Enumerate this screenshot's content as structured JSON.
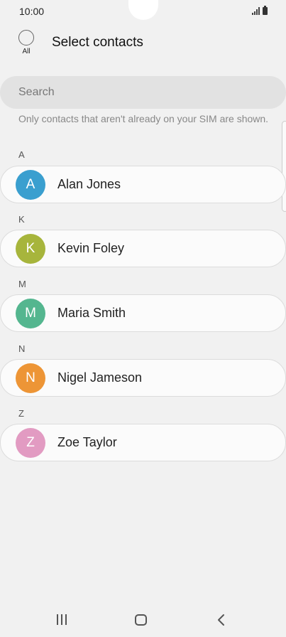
{
  "status_bar": {
    "time": "10:00"
  },
  "header": {
    "select_all_label": "All",
    "title": "Select contacts"
  },
  "search": {
    "placeholder": "Search"
  },
  "info_note": "Only contacts that aren't already on your SIM are shown.",
  "sections": [
    {
      "letter": "A",
      "contact": {
        "initial": "A",
        "name": "Alan Jones",
        "color": "#3a9fcf"
      }
    },
    {
      "letter": "K",
      "contact": {
        "initial": "K",
        "name": "Kevin Foley",
        "color": "#a7b53c"
      }
    },
    {
      "letter": "M",
      "contact": {
        "initial": "M",
        "name": "Maria Smith",
        "color": "#54b68f"
      }
    },
    {
      "letter": "N",
      "contact": {
        "initial": "N",
        "name": "Nigel Jameson",
        "color": "#ed9536"
      }
    },
    {
      "letter": "Z",
      "contact": {
        "initial": "Z",
        "name": "Zoe Taylor",
        "color": "#e29bc2"
      }
    }
  ],
  "nav_bar": {
    "icons": [
      "recent-apps-icon",
      "home-icon",
      "back-icon"
    ]
  }
}
